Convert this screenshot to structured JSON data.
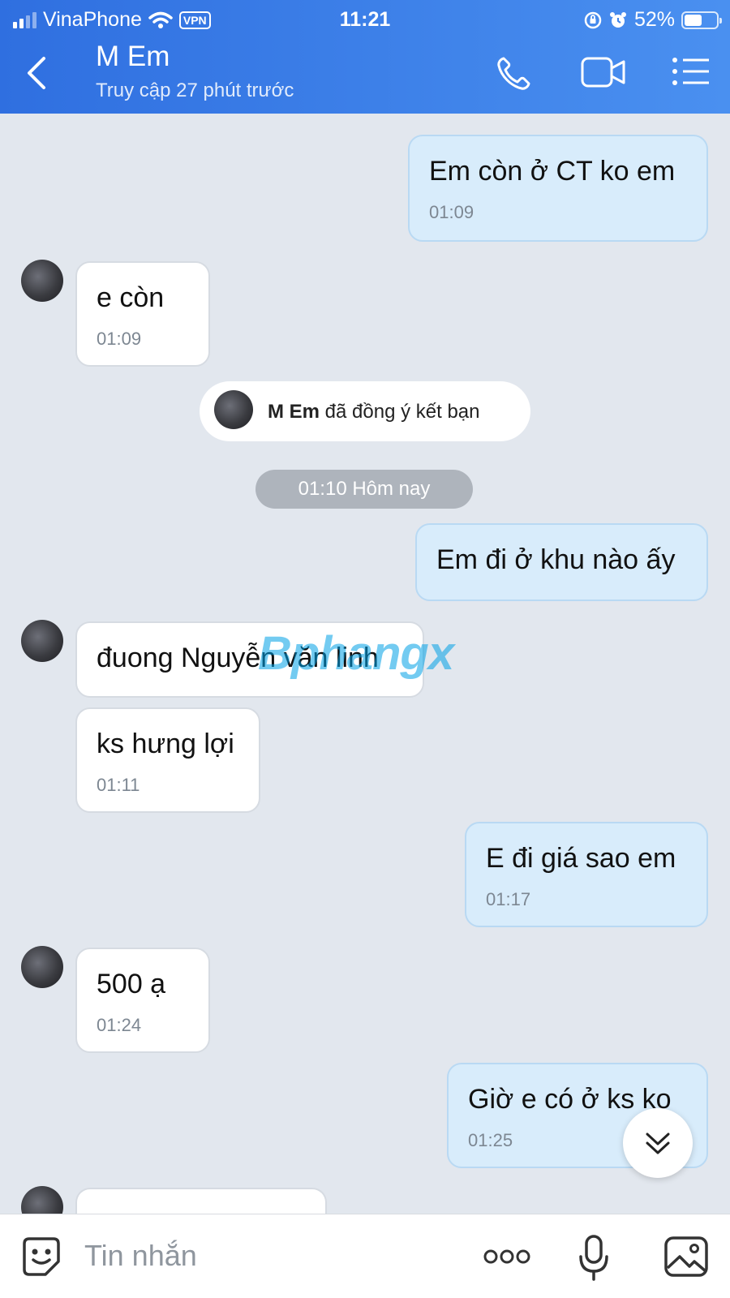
{
  "status_bar": {
    "carrier": "VinaPhone",
    "vpn": "VPN",
    "time": "11:21",
    "battery": "52%",
    "battery_level": 0.52
  },
  "header": {
    "contact_name": "M Em",
    "last_seen": "Truy cập 27 phút trước"
  },
  "messages": [
    {
      "text": "Em còn ở CT ko em",
      "time": "01:09"
    },
    {
      "text": "e còn",
      "time": "01:09"
    },
    {
      "text": "Em đi ở khu nào ấy"
    },
    {
      "text": "đuong Nguyễn văn linh"
    },
    {
      "text": "ks hưng lợi",
      "time": "01:11"
    },
    {
      "text": "E đi giá sao em",
      "time": "01:17"
    },
    {
      "text": "500 ạ",
      "time": "01:24"
    },
    {
      "text": "Giờ e có ở ks ko",
      "time": "01:25"
    }
  ],
  "friend_notice": {
    "name": "M Em",
    "text": " đã đồng ý kết bạn"
  },
  "time_separator": "01:10 Hôm nay",
  "watermark": "Bphangx",
  "input": {
    "placeholder": "Tin nhắn"
  },
  "icons": {
    "back": "chevron-left-icon",
    "call": "phone-icon",
    "video": "video-camera-icon",
    "menu": "list-menu-icon",
    "emoji": "sticker-emoji-icon",
    "more": "more-dots-icon",
    "mic": "microphone-icon",
    "gallery": "image-icon",
    "scroll": "double-chevron-down-icon"
  },
  "colors": {
    "header": "#3a7fe8",
    "bubble_me": "#d8ecfb",
    "bubble_them": "#ffffff",
    "background": "#e2e7ee"
  }
}
